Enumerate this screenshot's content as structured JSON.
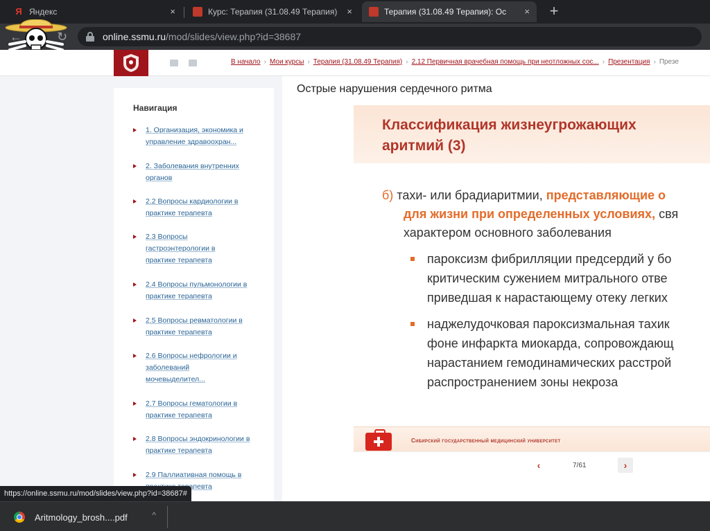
{
  "browser": {
    "tabs": [
      {
        "title": "Яндекс",
        "close": "×",
        "favicon_color": "#e6362a"
      },
      {
        "title": "Курс: Терапия (31.08.49 Терапия)",
        "close": "×",
        "favicon_color": "#c0392b"
      },
      {
        "title": "Терапия (31.08.49 Терапия): Ос",
        "close": "×",
        "favicon_color": "#c0392b"
      }
    ],
    "new_tab": "+",
    "back": "←",
    "reload": "↻",
    "url_host": "online.ssmu.ru",
    "url_path": "/mod/slides/view.php?id=38687"
  },
  "site": {
    "breadcrumb": [
      "В начало",
      "Мои курсы",
      "Терапия (31.08.49 Терапия)",
      "2.12 Первичная врачебная помощь при неотложных сос...",
      "Презентация",
      "Презе"
    ],
    "nav_title": "Навигация",
    "nav_items": [
      "1. Организация, экономика и управление здравоохран...",
      "2. Заболевания внутренних органов",
      "2.2 Вопросы кардиологии в практике терапевта",
      "2.3 Вопросы гастроэнтерологии в практике терапевта",
      "2.4 Вопросы пульмонологии в практике терапевта",
      "2.5 Вопросы ревматологии в практике терапевта",
      "2.6 Вопросы нефрологии и заболеваний мочевыделител...",
      "2.7 Вопросы гематологии в практике терапевта",
      "2.8 Вопросы эндокринологии в практике терапевта",
      "2.9 Паллиативная помощь в практике терапевта"
    ],
    "page_title": "Острые нарушения сердечного ритма"
  },
  "slide": {
    "heading": "Классификация жизнеугрожающих аритмий (3)",
    "lines": [
      {
        "marker": "б)",
        "plain": " тахи- или брадиаритмии, ",
        "em": "представляющие о",
        "rest": ""
      },
      {
        "em": "для жизни при определенных условиях,",
        "rest": " свя"
      },
      {
        "rest": "характером основного заболевания"
      }
    ],
    "bullets": [
      [
        "пароксизм фибрилляции предсердий у бо",
        "критическим сужением митрального отве",
        "приведшая к нарастающему отеку легких"
      ],
      [
        "наджелудочковая пароксизмальная тахик",
        "фоне инфаркта миокарда, сопровождающ",
        "нарастанием гемодинамических расстрой",
        "распространением зоны некроза"
      ]
    ],
    "footer_text": "Сибирский государственный медицинский университет",
    "pager": {
      "prev": "‹",
      "count": "7/61",
      "next": "›"
    }
  },
  "status_url": "https://online.ssmu.ru/mod/slides/view.php?id=38687#",
  "download": {
    "filename": "Aritmology_brosh....pdf",
    "chevron": "^"
  },
  "colors": {
    "brand": "#a0141b",
    "accent": "#e36c2a",
    "link": "#2a6496"
  }
}
